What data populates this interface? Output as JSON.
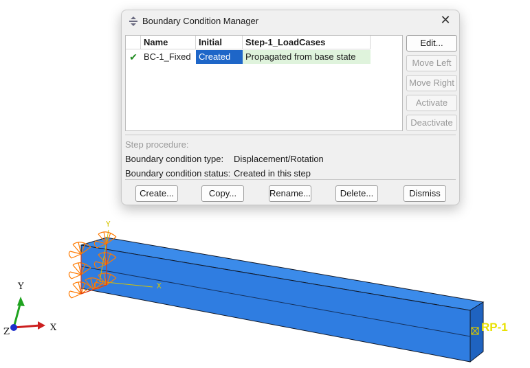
{
  "dialog": {
    "title": "Boundary Condition Manager",
    "close_symbol": "✕",
    "columns": [
      "Name",
      "Initial",
      "Step-1_LoadCases"
    ],
    "rows": [
      {
        "check": "✔",
        "name": "BC-1_Fixed",
        "initial": "Created",
        "step": "Propagated from base state"
      }
    ],
    "side_buttons": [
      {
        "label": "Edit...",
        "enabled": true
      },
      {
        "label": "Move Left",
        "enabled": false
      },
      {
        "label": "Move Right",
        "enabled": false
      },
      {
        "label": "Activate",
        "enabled": false
      },
      {
        "label": "Deactivate",
        "enabled": false
      }
    ],
    "step_procedure_label": "Step procedure:",
    "bc_type_label": "Boundary condition type:",
    "bc_type_value": "Displacement/Rotation",
    "bc_status_label": "Boundary condition status:",
    "bc_status_value": "Created in this step",
    "bottom_buttons": [
      "Create...",
      "Copy...",
      "Rename...",
      "Delete...",
      "Dismiss"
    ]
  },
  "viewport": {
    "beam_color": "#2f7de1",
    "bc_color": "#ff7a00",
    "ref_point_label": "RP-1",
    "local_axis_labels": {
      "x": "X",
      "y": "Y"
    },
    "triad_labels": {
      "x": "X",
      "y": "Y",
      "z": "Z"
    },
    "triad_colors": {
      "x": "#cc1f1f",
      "y": "#1fa31f",
      "z": "#1f2fcc"
    }
  }
}
